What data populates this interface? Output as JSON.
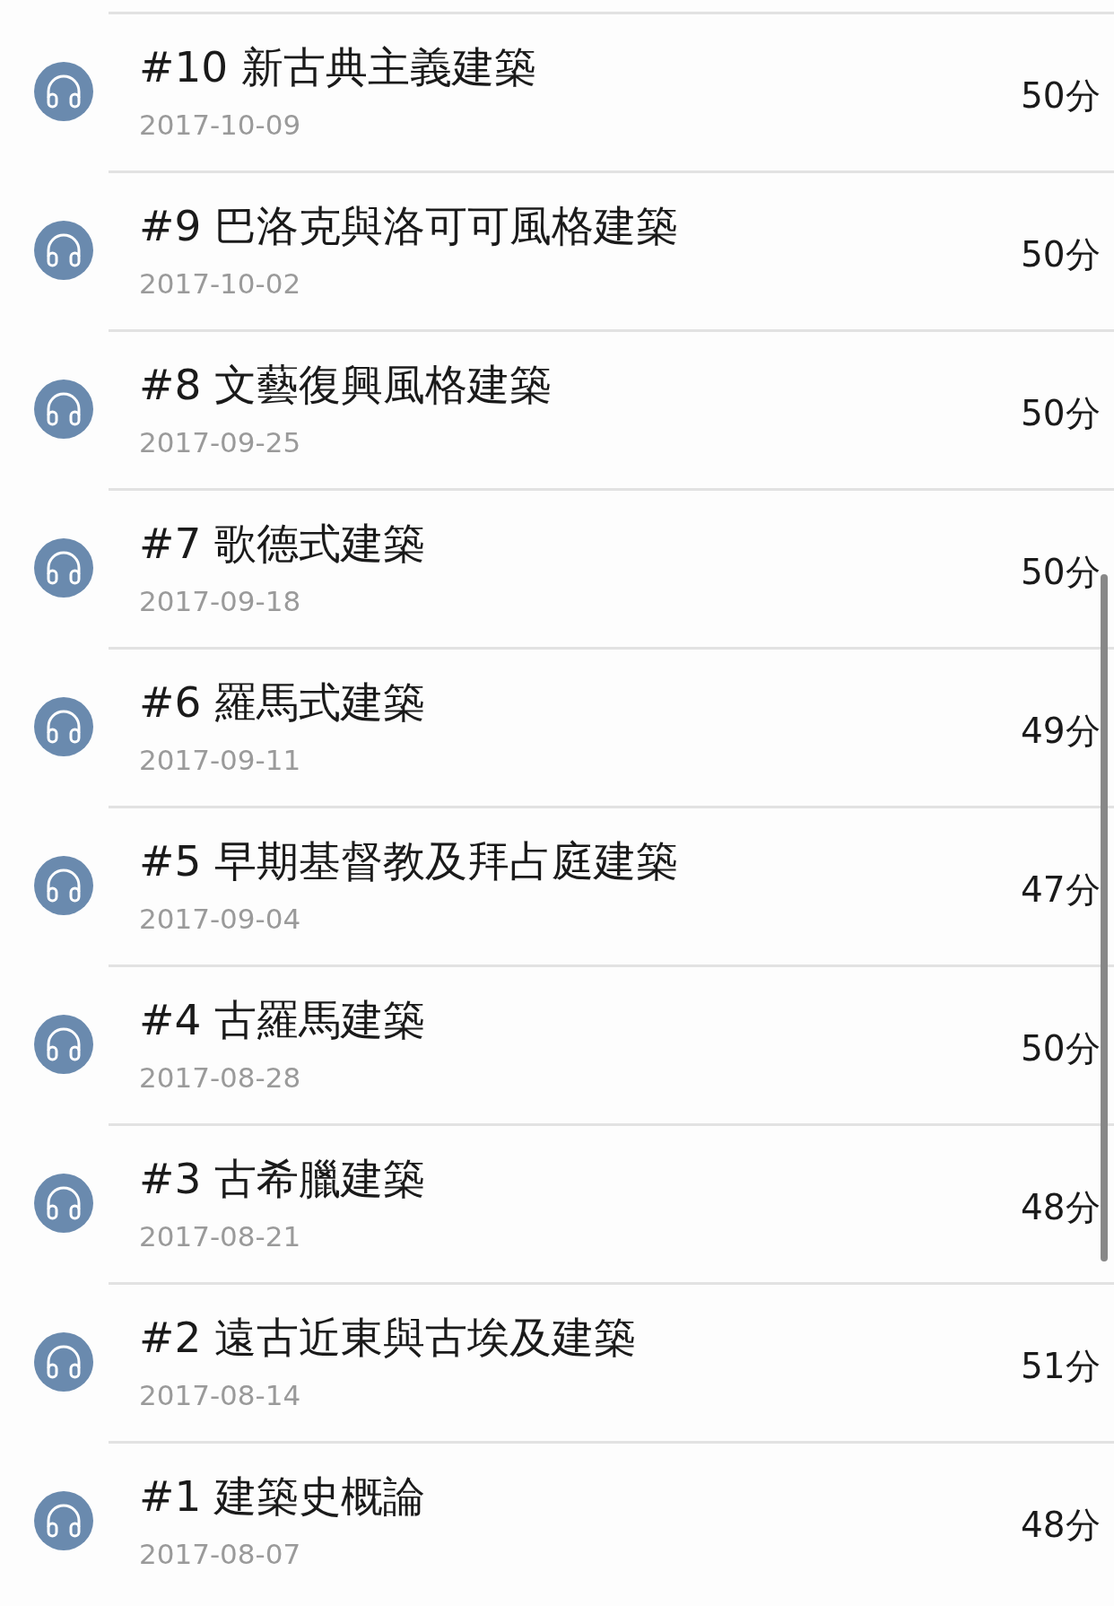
{
  "episodes": [
    {
      "title": "#10 新古典主義建築",
      "date": "2017-10-09",
      "duration": "50分"
    },
    {
      "title": "#9 巴洛克與洛可可風格建築",
      "date": "2017-10-02",
      "duration": "50分"
    },
    {
      "title": "#8 文藝復興風格建築",
      "date": "2017-09-25",
      "duration": "50分"
    },
    {
      "title": "#7 歌德式建築",
      "date": "2017-09-18",
      "duration": "50分"
    },
    {
      "title": "#6 羅馬式建築",
      "date": "2017-09-11",
      "duration": "49分"
    },
    {
      "title": "#5 早期基督教及拜占庭建築",
      "date": "2017-09-04",
      "duration": "47分"
    },
    {
      "title": "#4 古羅馬建築",
      "date": "2017-08-28",
      "duration": "50分"
    },
    {
      "title": "#3 古希臘建築",
      "date": "2017-08-21",
      "duration": "48分"
    },
    {
      "title": "#2 遠古近東與古埃及建築",
      "date": "2017-08-14",
      "duration": "51分"
    },
    {
      "title": "#1 建築史概論",
      "date": "2017-08-07",
      "duration": "48分"
    }
  ]
}
